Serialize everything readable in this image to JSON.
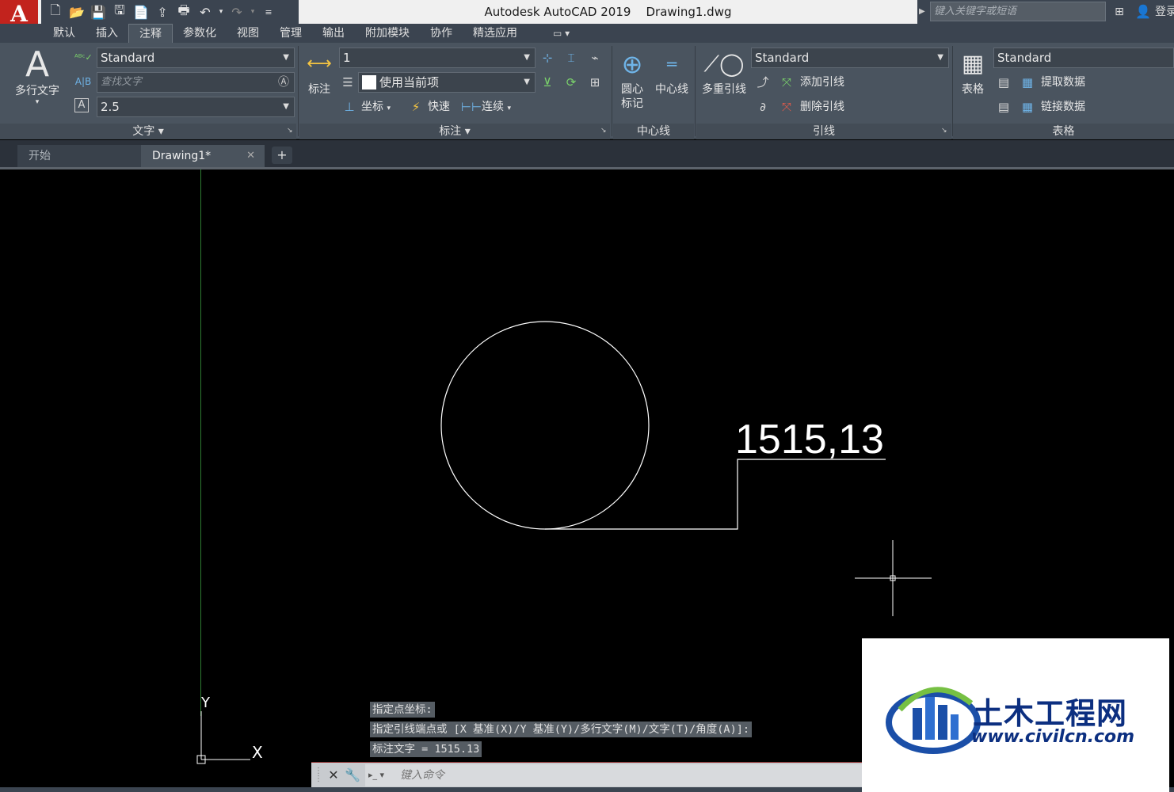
{
  "app": {
    "logo_letter": "A",
    "title": "Autodesk AutoCAD 2019    Drawing1.dwg",
    "search_placeholder": "键入关键字或短语",
    "login_label": "登录"
  },
  "ribbon_tabs": [
    "默认",
    "插入",
    "注释",
    "参数化",
    "视图",
    "管理",
    "输出",
    "附加模块",
    "协作",
    "精选应用"
  ],
  "active_tab": "注释",
  "text_panel": {
    "mtext_label": "多行文字",
    "style": "Standard",
    "find_placeholder": "查找文字",
    "height": "2.5",
    "title": "文字 ▾"
  },
  "dim_panel": {
    "dim_label": "标注",
    "dimstyle": "1",
    "layer": "使用当前项",
    "ordinate": "坐标",
    "quick": "快速",
    "continue": "连续",
    "title": "标注 ▾"
  },
  "centerline_panel": {
    "center_mark": "圆心\n标记",
    "centerline": "中心线",
    "title": "中心线"
  },
  "leader_panel": {
    "mleader": "多重引线",
    "style": "Standard",
    "add": "添加引线",
    "remove": "删除引线",
    "title": "引线"
  },
  "table_panel": {
    "table": "表格",
    "style": "Standard",
    "extract": "提取数据",
    "link": "链接数据",
    "title": "表格"
  },
  "file_tabs": {
    "start": "开始",
    "drawing": "Drawing1*"
  },
  "drawing": {
    "annotation": "1515,13",
    "ucs_y": "Y",
    "ucs_x": "X"
  },
  "command": {
    "history": [
      "指定点坐标:",
      "指定引线端点或 [X 基准(X)/Y 基准(Y)/多行文字(M)/文字(T)/角度(A)]:",
      "标注文字 = 1515.13"
    ],
    "placeholder": "键入命令"
  },
  "watermark": {
    "name": "土木工程网",
    "url": "www.civilcn.com"
  },
  "colors": {
    "canvas": "#000000",
    "ribbon": "#4a545f",
    "app_button": "#c2231d",
    "watermark_text": "#0c2f80"
  }
}
